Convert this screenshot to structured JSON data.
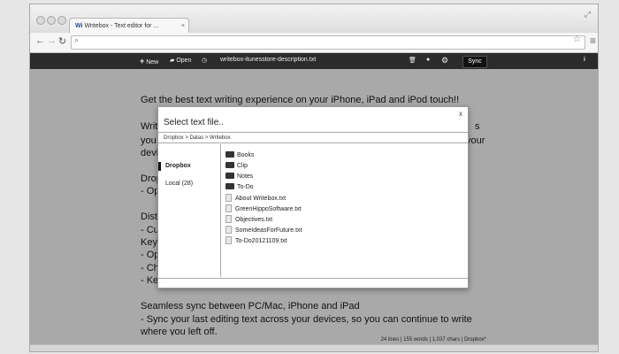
{
  "browser": {
    "tab_title": "Writebox - Text editor for ...",
    "tab_logo": "Wi",
    "url": ""
  },
  "app": {
    "new_label": "New",
    "open_label": "Open",
    "filename": "writebox-itunesstore-description.txt",
    "sync_label": "Sync"
  },
  "editor": {
    "lines": [
      {
        "text": "Get the best text writing experience on your iPhone, iPad and iPod touch!!"
      },
      {
        "text": "Writ"
      },
      {
        "text": "you"
      },
      {
        "text": "devi"
      },
      {
        "text": "Drop"
      },
      {
        "text": "- Op"
      },
      {
        "text": "Distr"
      },
      {
        "text": "- Cu"
      },
      {
        "text": "Keyb"
      },
      {
        "text": "- Op"
      },
      {
        "text": "- Ch"
      },
      {
        "text": "- Ke"
      },
      {
        "text": "Seamless sync between PC/Mac, iPhone and iPad"
      },
      {
        "text": "- Sync your last editing text across your devices, so you can continue to write"
      },
      {
        "text": "where you left off."
      }
    ],
    "right_fragments": [
      "s",
      "your"
    ],
    "status": "24 lines | 155 words | 1,037 chars | Dropbox*"
  },
  "dialog": {
    "title": "Select text file..",
    "close": "x",
    "breadcrumb": "Dropbox > Datas > Writebox",
    "sources": [
      {
        "label": "Dropbox",
        "selected": true
      },
      {
        "label": "Local (28)",
        "selected": false
      }
    ],
    "items": [
      {
        "name": "Books",
        "type": "folder"
      },
      {
        "name": "Clip",
        "type": "folder"
      },
      {
        "name": "Notes",
        "type": "folder"
      },
      {
        "name": "To-Do",
        "type": "folder"
      },
      {
        "name": "About Writebox.txt",
        "type": "file"
      },
      {
        "name": "GreenHippoSoftware.txt",
        "type": "file"
      },
      {
        "name": "Objectives.txt",
        "type": "file"
      },
      {
        "name": "SomeIdeasForFuture.txt",
        "type": "file"
      },
      {
        "name": "To-Do20121109.txt",
        "type": "file"
      }
    ]
  },
  "icons": [
    "back-icon",
    "forward-icon",
    "reload-icon",
    "search-icon",
    "star-icon",
    "menu-icon",
    "plus-icon",
    "folder-icon",
    "clock-icon",
    "trash-icon",
    "user-icon",
    "gear-icon",
    "info-icon",
    "resize-icon"
  ]
}
